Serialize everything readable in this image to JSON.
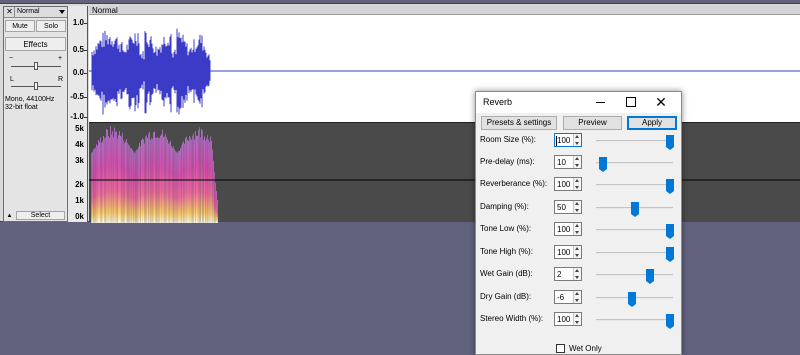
{
  "track": {
    "name": "Normal",
    "clip_name": "Normal",
    "close_glyph": "✕",
    "mute_label": "Mute",
    "solo_label": "Solo",
    "effects_label": "Effects",
    "gain_minus": "−",
    "gain_plus": "+",
    "pan_left": "L",
    "pan_right": "R",
    "info_line1": "Mono, 44100Hz",
    "info_line2": "32-bit float",
    "collapse_glyph": "▲",
    "select_label": "Select",
    "gain_slider_value": 0.5,
    "pan_slider_value": 0.5
  },
  "ruler": {
    "wave_ticks": [
      "1.0",
      "0.5",
      "0.0",
      "-0.5",
      "-1.0"
    ],
    "spec_ticks": [
      "5k",
      "4k",
      "3k",
      "2k",
      "1k",
      "0k"
    ]
  },
  "colors": {
    "waveform": "#3b3bc8",
    "accent": "#0078d7",
    "background": "#62627e"
  },
  "reverb": {
    "title": "Reverb",
    "minimize_icon": "minimize-icon",
    "maximize_icon": "maximize-icon",
    "close_glyph": "✕",
    "presets_label": "Presets & settings",
    "preview_label": "Preview",
    "apply_label": "Apply",
    "wet_only_label": "Wet Only",
    "wet_only_checked": false,
    "params": [
      {
        "label": "Room Size (%):",
        "value": "100",
        "slider": 1.0
      },
      {
        "label": "Pre-delay (ms):",
        "value": "10",
        "slider": 0.05
      },
      {
        "label": "Reverberance (%):",
        "value": "100",
        "slider": 1.0
      },
      {
        "label": "Damping (%):",
        "value": "50",
        "slider": 0.5
      },
      {
        "label": "Tone Low (%):",
        "value": "100",
        "slider": 1.0
      },
      {
        "label": "Tone High (%):",
        "value": "100",
        "slider": 1.0
      },
      {
        "label": "Wet Gain (dB):",
        "value": "2",
        "slider": 0.72
      },
      {
        "label": "Dry Gain (dB):",
        "value": "-6",
        "slider": 0.46
      },
      {
        "label": "Stereo Width (%):",
        "value": "100",
        "slider": 1.0
      }
    ]
  }
}
